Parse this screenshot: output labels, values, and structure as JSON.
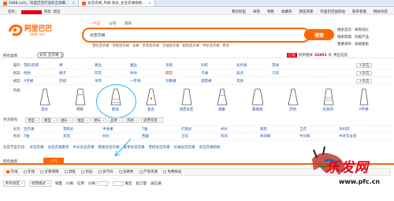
{
  "browser": {
    "tabs": [
      {
        "title": "1688.com，阿里巴巴打造的全球最...",
        "active": false
      },
      {
        "title": "女连衣裙_风格:淑女_女连衣裙规格...",
        "active": true
      }
    ]
  },
  "topnav": {
    "greeting": "您好，",
    "user_links": [
      "消息",
      "退出"
    ],
    "right_links": [
      "我的阿里",
      "采购",
      "销售",
      "收藏夹",
      "我是商家",
      "阿里巴巴国际站",
      "联系客服",
      "网站导航"
    ]
  },
  "logo": {
    "name": "阿里巴巴",
    "url": "1688.com"
  },
  "search": {
    "tabs": [
      "产品",
      "公司",
      "资讯"
    ],
    "active_tab": "产品",
    "query": "女连衣裙",
    "button": "搜索",
    "right_links": [
      "搜索首页",
      "采购询价",
      "搜索帮助",
      "同类产品",
      "我要发布",
      "高级搜索"
    ],
    "hot_keywords": [
      "雪纺连衣裙",
      "毛呢连衣裙",
      "长裙",
      "女装连衣裙",
      "无袖连衣裙",
      "超短连衣裙",
      "中长连衣裙",
      "更多"
    ]
  },
  "category": {
    "label": "所有类目",
    "selected": "女装",
    "sub": "连衣裙",
    "dropdown_icon": "chevron-down-icon",
    "promo_badge": "已选",
    "promo_text": "找到相关",
    "promo_count": "26801",
    "promo_unit": "条",
    "promo_link": "供应信息"
  },
  "attributes": [
    {
      "key": "面料:",
      "values": [
        "雪纺/纺织",
        "棉",
        "真丝",
        "蕾丝",
        "毛呢",
        "针织",
        "化纤类",
        "其他"
      ],
      "more": "+多选"
    },
    {
      "key": "图案:",
      "values": [
        "纯色",
        "格子",
        "印花",
        "条纹",
        "碎花",
        "卡通",
        "波点",
        "几何"
      ],
      "highlight": "碎花",
      "more": "+多选"
    },
    {
      "key": "裙型:",
      "values": [
        "A字裙",
        "百褶",
        "吊带",
        "一字领",
        "包臀裙",
        "蛋糕裙",
        "其他"
      ],
      "more": "+多选"
    }
  ],
  "dress_styles": {
    "key": "风格:",
    "items": [
      "淑女",
      "韩版",
      "欧美",
      "复古",
      "波西米亚",
      "通勤",
      "蓬蓬裙",
      "其他",
      "民族风",
      "A字裙"
    ]
  },
  "more_attrs": {
    "label": "更多属性:",
    "selects": [
      "领型",
      "腰型",
      "袖长",
      "袖型",
      "裙长",
      "品牌",
      "风格",
      "适用年龄"
    ]
  },
  "cat_rows": [
    {
      "key": "女装:",
      "values": [
        "连衣裙",
        "雪纺衫",
        "半身裙",
        "T恤",
        "打底衫",
        "衬衫",
        "套装",
        "卫衣",
        "孕妇装"
      ]
    },
    {
      "key": "男装:",
      "values": [
        "T恤",
        "夹克",
        "衬衫",
        "西服",
        "卫衣",
        "风衣",
        "休闲裤",
        "牛仔裤",
        "中老年女装"
      ]
    }
  ],
  "related": {
    "label": "您是不是在找:",
    "values": [
      "女连衣裙",
      "女连衣裙夏装",
      "中长女连衣裙",
      "韩版女连衣裙",
      "夏季女连衣裙",
      "雪纺女连衣裙",
      "长袖女连衣裙",
      "女连衣裙新款"
    ]
  },
  "result": {
    "tab_label": "所有类目",
    "active_tab": "人气"
  },
  "filters": [
    {
      "label": "在线",
      "checked": true
    },
    {
      "label": "在线",
      "checked": false
    },
    {
      "label": "买家保障",
      "checked": false
    },
    {
      "label": "混批",
      "checked": false
    },
    {
      "label": "新品",
      "checked": false
    },
    {
      "label": "多尺码",
      "checked": false
    },
    {
      "label": "多颜色",
      "checked": false
    },
    {
      "label": "产地货源",
      "checked": false
    },
    {
      "label": "免费样品",
      "checked": false
    }
  ],
  "sortbar": {
    "region": "所有地区",
    "model": "经营模式",
    "sort_links": [
      "销量",
      "价格",
      "信用"
    ],
    "price_label": "价格",
    "range_sep": "-",
    "confirm": "确定",
    "min_order": "起订量",
    "vip": "诚信通"
  },
  "watermark": {
    "text": "乐发网",
    "url": "www.pfc.cn"
  },
  "colors": {
    "accent": "#ff6600",
    "red": "#e60012",
    "link": "#2255aa",
    "annotation": "#29b6f6"
  }
}
